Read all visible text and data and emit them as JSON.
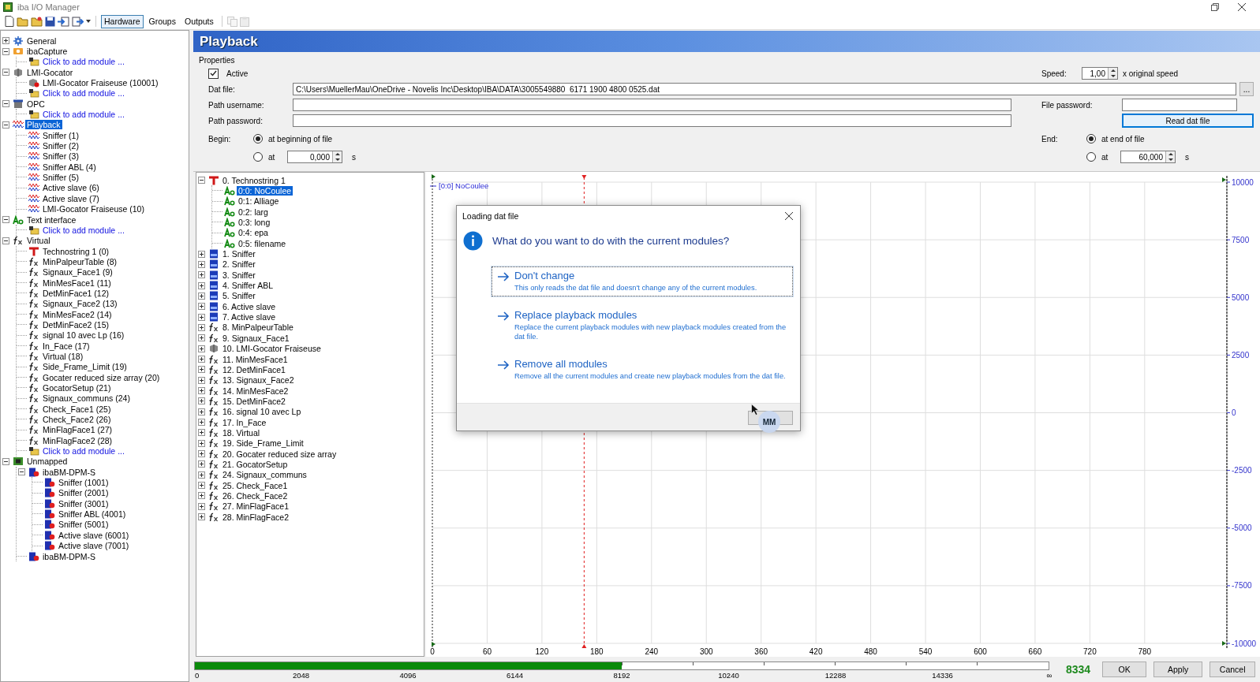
{
  "window": {
    "title": "iba I/O Manager"
  },
  "view_tabs": [
    {
      "label": "Hardware",
      "selected": true
    },
    {
      "label": "Groups",
      "selected": false
    },
    {
      "label": "Outputs",
      "selected": false
    }
  ],
  "hardware_tree": [
    {
      "label": "General",
      "kind": "general",
      "expanded": false,
      "selected": false
    },
    {
      "label": "ibaCapture",
      "kind": "capture",
      "expanded": true,
      "selected": false,
      "children": [
        {
          "label": "Click to add module ...",
          "kind": "add",
          "selected": false
        }
      ]
    },
    {
      "label": "LMI-Gocator",
      "kind": "gocator",
      "expanded": true,
      "selected": false,
      "children": [
        {
          "label": "LMI-Gocator Fraiseuse (10001)",
          "kind": "gocator-module",
          "selected": false
        },
        {
          "label": "Click to add module ...",
          "kind": "add",
          "selected": false
        }
      ]
    },
    {
      "label": "OPC",
      "kind": "opc",
      "expanded": true,
      "selected": false,
      "children": [
        {
          "label": "Click to add module ...",
          "kind": "add",
          "selected": false
        }
      ]
    },
    {
      "label": "Playback",
      "kind": "playback",
      "expanded": true,
      "selected": true,
      "children": [
        {
          "label": "Sniffer (1)",
          "kind": "playback",
          "selected": false
        },
        {
          "label": "Sniffer (2)",
          "kind": "playback",
          "selected": false
        },
        {
          "label": "Sniffer (3)",
          "kind": "playback",
          "selected": false
        },
        {
          "label": "Sniffer ABL (4)",
          "kind": "playback",
          "selected": false
        },
        {
          "label": "Sniffer (5)",
          "kind": "playback",
          "selected": false
        },
        {
          "label": "Active slave (6)",
          "kind": "playback",
          "selected": false
        },
        {
          "label": "Active slave (7)",
          "kind": "playback",
          "selected": false
        },
        {
          "label": "LMI-Gocator Fraiseuse (10)",
          "kind": "playback",
          "selected": false
        }
      ]
    },
    {
      "label": "Text interface",
      "kind": "text",
      "expanded": true,
      "selected": false,
      "children": [
        {
          "label": "Click to add module ...",
          "kind": "add",
          "selected": false
        }
      ]
    },
    {
      "label": "Virtual",
      "kind": "virtual",
      "expanded": true,
      "selected": false,
      "children": [
        {
          "label": "Technostring 1 (0)",
          "kind": "technostring",
          "selected": false
        },
        {
          "label": "MinPalpeurTable (8)",
          "kind": "virtual",
          "selected": false
        },
        {
          "label": "Signaux_Face1 (9)",
          "kind": "virtual",
          "selected": false
        },
        {
          "label": "MinMesFace1 (11)",
          "kind": "virtual",
          "selected": false
        },
        {
          "label": "DetMinFace1 (12)",
          "kind": "virtual",
          "selected": false
        },
        {
          "label": "Signaux_Face2 (13)",
          "kind": "virtual",
          "selected": false
        },
        {
          "label": "MinMesFace2 (14)",
          "kind": "virtual",
          "selected": false
        },
        {
          "label": "DetMinFace2 (15)",
          "kind": "virtual",
          "selected": false
        },
        {
          "label": "signal 10 avec Lp (16)",
          "kind": "virtual",
          "selected": false
        },
        {
          "label": "In_Face (17)",
          "kind": "virtual",
          "selected": false
        },
        {
          "label": "Virtual (18)",
          "kind": "virtual",
          "selected": false
        },
        {
          "label": "Side_Frame_Limit (19)",
          "kind": "virtual",
          "selected": false
        },
        {
          "label": "Gocater reduced size array (20)",
          "kind": "virtual",
          "selected": false
        },
        {
          "label": "GocatorSetup (21)",
          "kind": "virtual",
          "selected": false
        },
        {
          "label": "Signaux_communs (24)",
          "kind": "virtual",
          "selected": false
        },
        {
          "label": "Check_Face1 (25)",
          "kind": "virtual",
          "selected": false
        },
        {
          "label": "Check_Face2 (26)",
          "kind": "virtual",
          "selected": false
        },
        {
          "label": "MinFlagFace1 (27)",
          "kind": "virtual",
          "selected": false
        },
        {
          "label": "MinFlagFace2 (28)",
          "kind": "virtual",
          "selected": false
        },
        {
          "label": "Click to add module ...",
          "kind": "add",
          "selected": false
        }
      ]
    },
    {
      "label": "Unmapped",
      "kind": "unmapped",
      "expanded": true,
      "selected": false,
      "children": [
        {
          "label": "ibaBM-DPM-S",
          "kind": "device",
          "expanded": true,
          "selected": false,
          "children": [
            {
              "label": "Sniffer (1001)",
              "kind": "device",
              "selected": false
            },
            {
              "label": "Sniffer (2001)",
              "kind": "device",
              "selected": false
            },
            {
              "label": "Sniffer (3001)",
              "kind": "device",
              "selected": false
            },
            {
              "label": "Sniffer ABL (4001)",
              "kind": "device",
              "selected": false
            },
            {
              "label": "Sniffer (5001)",
              "kind": "device",
              "selected": false
            },
            {
              "label": "Active slave (6001)",
              "kind": "device",
              "selected": false
            },
            {
              "label": "Active slave (7001)",
              "kind": "device",
              "selected": false
            }
          ]
        },
        {
          "label": "ibaBM-DPM-S",
          "kind": "device",
          "selected": false
        }
      ]
    }
  ],
  "panel": {
    "title": "Playback"
  },
  "properties": {
    "title": "Properties",
    "active": {
      "label": "Active",
      "checked": true
    },
    "speed": {
      "label": "Speed:",
      "value": "1,00",
      "unit": "x original speed"
    },
    "dat_file": {
      "label": "Dat file:",
      "value": "C:\\Users\\MuellerMau\\OneDrive - Novelis Inc\\Desktop\\IBA\\DATA\\3005549880  6171 1900 4800 0525.dat",
      "browse": "..."
    },
    "path_username": {
      "label": "Path username:"
    },
    "path_password": {
      "label": "Path password:"
    },
    "file_password": {
      "label": "File password:"
    },
    "read_button": "Read dat file",
    "begin": {
      "label": "Begin:",
      "options": [
        {
          "label": "at beginning of file",
          "selected": true
        },
        {
          "label": "at",
          "selected": false,
          "value": "0,000",
          "unit": "s"
        }
      ]
    },
    "end": {
      "label": "End:",
      "options": [
        {
          "label": "at end of file",
          "selected": true
        },
        {
          "label": "at",
          "selected": false,
          "value": "60,000",
          "unit": "s"
        }
      ]
    }
  },
  "modules_tree": [
    {
      "label": "0. Technostring 1",
      "kind": "technostring",
      "expanded": true,
      "selected": false,
      "children": [
        {
          "label": "0:0: NoCoulee",
          "kind": "text",
          "selected": true
        },
        {
          "label": "0:1: Alliage",
          "kind": "text",
          "selected": false
        },
        {
          "label": "0:2: larg",
          "kind": "text",
          "selected": false
        },
        {
          "label": "0:3: long",
          "kind": "text",
          "selected": false
        },
        {
          "label": "0:4: epa",
          "kind": "text",
          "selected": false
        },
        {
          "label": "0:5: filename",
          "kind": "text",
          "selected": false
        }
      ]
    },
    {
      "label": "1. Sniffer",
      "kind": "dp",
      "expanded": false,
      "selected": false
    },
    {
      "label": "2. Sniffer",
      "kind": "dp",
      "expanded": false,
      "selected": false
    },
    {
      "label": "3. Sniffer",
      "kind": "dp",
      "expanded": false,
      "selected": false
    },
    {
      "label": "4. Sniffer ABL",
      "kind": "dp",
      "expanded": false,
      "selected": false
    },
    {
      "label": "5. Sniffer",
      "kind": "dp",
      "expanded": false,
      "selected": false
    },
    {
      "label": "6. Active slave",
      "kind": "dp",
      "expanded": false,
      "selected": false
    },
    {
      "label": "7. Active slave",
      "kind": "dp",
      "expanded": false,
      "selected": false
    },
    {
      "label": "8. MinPalpeurTable",
      "kind": "virtual",
      "expanded": false,
      "selected": false
    },
    {
      "label": "9. Signaux_Face1",
      "kind": "virtual",
      "expanded": false,
      "selected": false
    },
    {
      "label": "10. LMI-Gocator Fraiseuse",
      "kind": "gocator",
      "expanded": false,
      "selected": false
    },
    {
      "label": "11. MinMesFace1",
      "kind": "virtual",
      "expanded": false,
      "selected": false
    },
    {
      "label": "12. DetMinFace1",
      "kind": "virtual",
      "expanded": false,
      "selected": false
    },
    {
      "label": "13. Signaux_Face2",
      "kind": "virtual",
      "expanded": false,
      "selected": false
    },
    {
      "label": "14. MinMesFace2",
      "kind": "virtual",
      "expanded": false,
      "selected": false
    },
    {
      "label": "15. DetMinFace2",
      "kind": "virtual",
      "expanded": false,
      "selected": false
    },
    {
      "label": "16. signal 10 avec Lp",
      "kind": "virtual",
      "expanded": false,
      "selected": false
    },
    {
      "label": "17. In_Face",
      "kind": "virtual",
      "expanded": false,
      "selected": false
    },
    {
      "label": "18. Virtual",
      "kind": "virtual",
      "expanded": false,
      "selected": false
    },
    {
      "label": "19. Side_Frame_Limit",
      "kind": "virtual",
      "expanded": false,
      "selected": false
    },
    {
      "label": "20. Gocater reduced size array",
      "kind": "virtual",
      "expanded": false,
      "selected": false
    },
    {
      "label": "21. GocatorSetup",
      "kind": "virtual",
      "expanded": false,
      "selected": false
    },
    {
      "label": "24. Signaux_communs",
      "kind": "virtual",
      "expanded": false,
      "selected": false
    },
    {
      "label": "25. Check_Face1",
      "kind": "virtual",
      "expanded": false,
      "selected": false
    },
    {
      "label": "26. Check_Face2",
      "kind": "virtual",
      "expanded": false,
      "selected": false
    },
    {
      "label": "27. MinFlagFace1",
      "kind": "virtual",
      "expanded": false,
      "selected": false
    },
    {
      "label": "28. MinFlagFace2",
      "kind": "virtual",
      "expanded": false,
      "selected": false
    }
  ],
  "chart": {
    "chart_data": {
      "type": "line",
      "grid": true,
      "ylim": [
        -10000,
        10000
      ],
      "categories": [
        "0",
        "60",
        "120",
        "180",
        "240",
        "300",
        "360",
        "420",
        "480",
        "540",
        "600",
        "660",
        "720",
        "780"
      ],
      "yticks": [
        -10000,
        -7500,
        -5000,
        -2500,
        0,
        2500,
        5000,
        7500,
        10000
      ],
      "series": [
        {
          "name": "[0:0] NoCoulee",
          "color": "#2b2bd6",
          "values": [
            null,
            null,
            null,
            null,
            null,
            null,
            null,
            null,
            null,
            null,
            null,
            null,
            null,
            null
          ]
        }
      ]
    }
  },
  "dialog": {
    "title": "Loading dat file",
    "question": "What do you want to do with the current modules?",
    "options": [
      {
        "title": "Don't change",
        "description": "This only reads the dat file and doesn't change any of the current modules.",
        "focused": true
      },
      {
        "title": "Replace playback modules",
        "description": "Replace the current playback modules with new playback modules created from the dat file.",
        "focused": false
      },
      {
        "title": "Remove all modules",
        "description": "Remove all the current modules and create new playback modules from the dat file.",
        "focused": false
      }
    ],
    "badge": "MM"
  },
  "footer": {
    "progress": {
      "level": 0.5,
      "scale": [
        "0",
        "2048",
        "4096",
        "6144",
        "8192",
        "10240",
        "12288",
        "14336",
        "∞"
      ]
    },
    "count": "8334",
    "buttons": [
      "OK",
      "Apply",
      "Cancel"
    ]
  }
}
